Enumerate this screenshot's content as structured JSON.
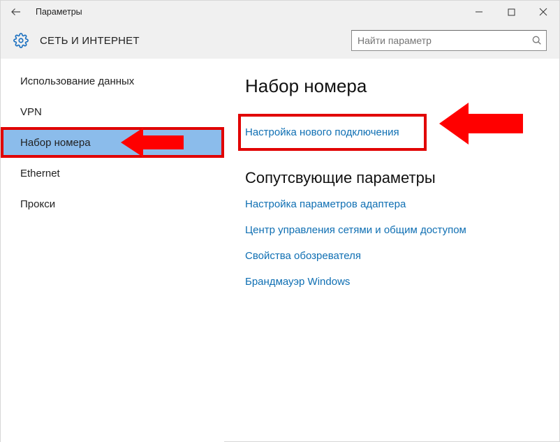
{
  "window": {
    "title": "Параметры"
  },
  "header": {
    "section": "СЕТЬ И ИНТЕРНЕТ"
  },
  "search": {
    "placeholder": "Найти параметр"
  },
  "sidebar": {
    "items": [
      {
        "label": "Использование данных"
      },
      {
        "label": "VPN"
      },
      {
        "label": "Набор номера"
      },
      {
        "label": "Ethernet"
      },
      {
        "label": "Прокси"
      }
    ],
    "selected_index": 2
  },
  "main": {
    "heading": "Набор номера",
    "new_connection_link": "Настройка нового подключения",
    "related_heading": "Сопутсвующие параметры",
    "related_links": [
      "Настройка параметров адаптера",
      "Центр управления сетями и общим доступом",
      "Свойства обозревателя",
      "Брандмауэр Windows"
    ]
  }
}
